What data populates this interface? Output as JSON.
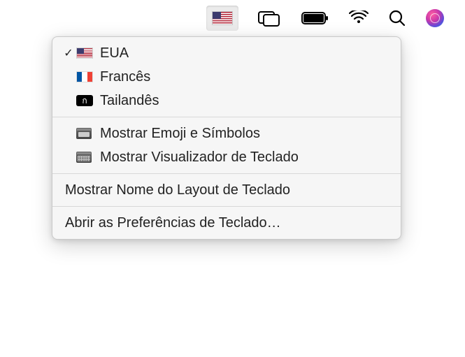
{
  "menubar": {
    "input_menu_active": true
  },
  "dropdown": {
    "languages": [
      {
        "label": "EUA",
        "checked": true,
        "icon": "flag-usa"
      },
      {
        "label": "Francês",
        "checked": false,
        "icon": "flag-france"
      },
      {
        "label": "Tailandês",
        "checked": false,
        "icon": "thai"
      }
    ],
    "viewers": [
      {
        "label": "Mostrar Emoji e Símbolos",
        "icon": "emoji-viewer"
      },
      {
        "label": "Mostrar Visualizador de Teclado",
        "icon": "keyboard-viewer"
      }
    ],
    "show_layout_name": "Mostrar Nome do Layout de Teclado",
    "open_prefs": "Abrir as Preferências de Teclado…"
  }
}
